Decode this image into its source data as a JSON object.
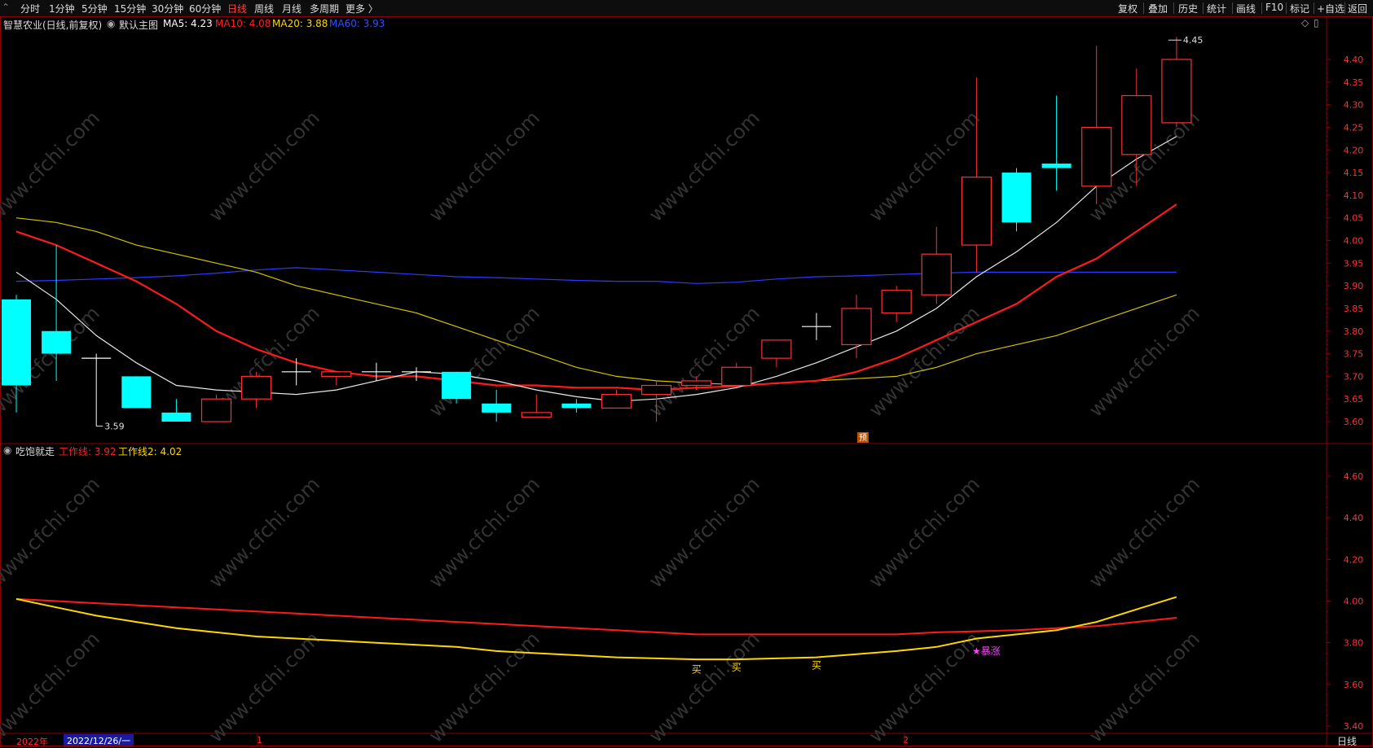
{
  "toolbar": {
    "periods": [
      "分时",
      "1分钟",
      "5分钟",
      "15分钟",
      "30分钟",
      "60分钟",
      "日线",
      "周线",
      "月线",
      "多周期",
      "更多 〉"
    ],
    "active_period": "日线",
    "right_buttons": [
      "复权",
      "叠加",
      "历史",
      "统计",
      "画线",
      "F10",
      "标记",
      "+自选",
      "返回"
    ]
  },
  "main_panel": {
    "title": "智慧农业(日线,前复权)",
    "template": "默认主图",
    "ma": [
      {
        "label": "MA5: 4.23",
        "color": "#ffffff"
      },
      {
        "label": "MA10: 4.08",
        "color": "#ff2020"
      },
      {
        "label": "MA20: 3.88",
        "color": "#ffd700"
      },
      {
        "label": "MA60: 3.93",
        "color": "#3050ff"
      }
    ],
    "y_ticks": [
      "4.40",
      "4.35",
      "4.30",
      "4.25",
      "4.20",
      "4.15",
      "4.10",
      "4.05",
      "4.00",
      "3.95",
      "3.90",
      "3.85",
      "3.80",
      "3.75",
      "3.70",
      "3.65",
      "3.60"
    ],
    "annotations": {
      "high": "4.45",
      "low": "3.59",
      "pre_mark": "预"
    }
  },
  "sub_panel": {
    "title": "吃饱就走",
    "lines": [
      {
        "label": "工作线: 3.92",
        "color": "#ff2020"
      },
      {
        "label": "工作线2: 4.02",
        "color": "#ffd700"
      }
    ],
    "y_ticks": [
      "4.60",
      "4.40",
      "4.20",
      "4.00",
      "3.80",
      "3.60",
      "3.40"
    ],
    "signals": [
      {
        "text": "买",
        "color": "#ffd700"
      },
      {
        "text": "买",
        "color": "#ffd700"
      },
      {
        "text": "买",
        "color": "#ffd700"
      },
      {
        "text": "★暴涨",
        "color": "#ff40ff"
      }
    ]
  },
  "x_axis": {
    "year_label": "2022年",
    "cursor_date": "2022/12/26/一",
    "month_marks": [
      "1",
      "2"
    ],
    "period_label": "日线"
  },
  "watermark": "www.cfchi.com",
  "chart_data": {
    "type": "candlestick",
    "candles": [
      {
        "o": 3.87,
        "c": 3.68,
        "h": 3.88,
        "l": 3.62
      },
      {
        "o": 3.8,
        "c": 3.75,
        "h": 3.99,
        "l": 3.69
      },
      {
        "o": 3.74,
        "c": 3.74,
        "h": 3.75,
        "l": 3.59
      },
      {
        "o": 3.7,
        "c": 3.63,
        "h": 3.7,
        "l": 3.63
      },
      {
        "o": 3.62,
        "c": 3.6,
        "h": 3.65,
        "l": 3.6
      },
      {
        "o": 3.6,
        "c": 3.65,
        "h": 3.66,
        "l": 3.6
      },
      {
        "o": 3.65,
        "c": 3.7,
        "h": 3.71,
        "l": 3.63
      },
      {
        "o": 3.71,
        "c": 3.71,
        "h": 3.74,
        "l": 3.68
      },
      {
        "o": 3.7,
        "c": 3.71,
        "h": 3.71,
        "l": 3.68
      },
      {
        "o": 3.71,
        "c": 3.71,
        "h": 3.73,
        "l": 3.69
      },
      {
        "o": 3.71,
        "c": 3.71,
        "h": 3.72,
        "l": 3.69
      },
      {
        "o": 3.71,
        "c": 3.65,
        "h": 3.71,
        "l": 3.64
      },
      {
        "o": 3.64,
        "c": 3.62,
        "h": 3.67,
        "l": 3.6
      },
      {
        "o": 3.61,
        "c": 3.62,
        "h": 3.66,
        "l": 3.61
      },
      {
        "o": 3.64,
        "c": 3.63,
        "h": 3.65,
        "l": 3.62
      },
      {
        "o": 3.63,
        "c": 3.66,
        "h": 3.67,
        "l": 3.63
      },
      {
        "o": 3.66,
        "c": 3.68,
        "h": 3.69,
        "l": 3.6
      },
      {
        "o": 3.68,
        "c": 3.69,
        "h": 3.7,
        "l": 3.67
      },
      {
        "o": 3.68,
        "c": 3.72,
        "h": 3.73,
        "l": 3.68
      },
      {
        "o": 3.74,
        "c": 3.78,
        "h": 3.78,
        "l": 3.72
      },
      {
        "o": 3.81,
        "c": 3.81,
        "h": 3.84,
        "l": 3.78
      },
      {
        "o": 3.77,
        "c": 3.85,
        "h": 3.88,
        "l": 3.74
      },
      {
        "o": 3.84,
        "c": 3.89,
        "h": 3.9,
        "l": 3.82
      },
      {
        "o": 3.88,
        "c": 3.97,
        "h": 4.03,
        "l": 3.86
      },
      {
        "o": 3.99,
        "c": 4.14,
        "h": 4.36,
        "l": 3.93
      },
      {
        "o": 4.15,
        "c": 4.04,
        "h": 4.16,
        "l": 4.02
      },
      {
        "o": 4.17,
        "c": 4.16,
        "h": 4.32,
        "l": 4.11
      },
      {
        "o": 4.12,
        "c": 4.25,
        "h": 4.43,
        "l": 4.08
      },
      {
        "o": 4.19,
        "c": 4.32,
        "h": 4.38,
        "l": 4.12
      },
      {
        "o": 4.26,
        "c": 4.4,
        "h": 4.45,
        "l": 4.25
      }
    ],
    "ma5": [
      3.93,
      3.87,
      3.79,
      3.73,
      3.68,
      3.67,
      3.665,
      3.66,
      3.67,
      3.69,
      3.71,
      3.705,
      3.69,
      3.67,
      3.655,
      3.645,
      3.65,
      3.66,
      3.675,
      3.7,
      3.73,
      3.765,
      3.8,
      3.85,
      3.92,
      3.975,
      4.04,
      4.12,
      4.18,
      4.23
    ],
    "ma10": [
      4.02,
      3.99,
      3.95,
      3.91,
      3.86,
      3.8,
      3.76,
      3.73,
      3.71,
      3.7,
      3.7,
      3.69,
      3.68,
      3.68,
      3.675,
      3.675,
      3.67,
      3.675,
      3.678,
      3.685,
      3.69,
      3.71,
      3.74,
      3.78,
      3.82,
      3.86,
      3.92,
      3.96,
      4.02,
      4.08
    ],
    "ma20": [
      4.05,
      4.04,
      4.02,
      3.99,
      3.97,
      3.95,
      3.93,
      3.9,
      3.88,
      3.86,
      3.84,
      3.81,
      3.78,
      3.75,
      3.72,
      3.7,
      3.69,
      3.685,
      3.682,
      3.684,
      3.69,
      3.695,
      3.7,
      3.72,
      3.75,
      3.77,
      3.79,
      3.82,
      3.85,
      3.88
    ],
    "ma60": [
      3.91,
      3.912,
      3.915,
      3.918,
      3.922,
      3.928,
      3.935,
      3.94,
      3.935,
      3.93,
      3.925,
      3.92,
      3.918,
      3.915,
      3.912,
      3.91,
      3.91,
      3.905,
      3.908,
      3.915,
      3.92,
      3.922,
      3.925,
      3.928,
      3.93,
      3.93,
      3.93,
      3.93,
      3.93,
      3.93
    ],
    "work_line": [
      4.01,
      4.0,
      3.99,
      3.98,
      3.97,
      3.96,
      3.95,
      3.94,
      3.93,
      3.92,
      3.91,
      3.9,
      3.89,
      3.88,
      3.87,
      3.86,
      3.85,
      3.84,
      3.84,
      3.84,
      3.84,
      3.84,
      3.84,
      3.85,
      3.855,
      3.86,
      3.87,
      3.88,
      3.9,
      3.92
    ],
    "work_line2": [
      4.01,
      3.97,
      3.93,
      3.9,
      3.87,
      3.85,
      3.83,
      3.82,
      3.81,
      3.8,
      3.79,
      3.78,
      3.76,
      3.75,
      3.74,
      3.73,
      3.725,
      3.72,
      3.72,
      3.725,
      3.73,
      3.745,
      3.76,
      3.78,
      3.82,
      3.84,
      3.86,
      3.9,
      3.96,
      4.02
    ]
  }
}
